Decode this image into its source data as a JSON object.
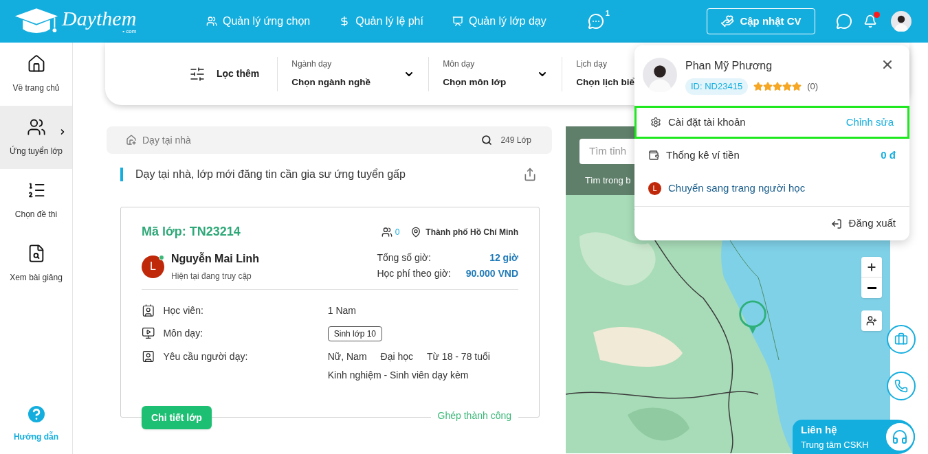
{
  "header": {
    "logo": {
      "name": "Daythem",
      "suffix": "• com"
    },
    "nav": [
      {
        "label": "Quản lý ứng chọn"
      },
      {
        "label": "Quản lý lệ phí"
      },
      {
        "label": "Quản lý lớp dạy"
      }
    ],
    "more_badge": "1",
    "cv_button": "Cập nhật CV",
    "notification_dot": true
  },
  "sidebar": {
    "items": [
      {
        "label": "Về trang chủ",
        "selected": false
      },
      {
        "label": "Ứng tuyển lớp",
        "selected": true
      },
      {
        "label": "Chọn đề thi",
        "selected": false
      },
      {
        "label": "Xem bài giảng",
        "selected": false
      }
    ],
    "help": "Hướng dẫn"
  },
  "filter_bar": {
    "more_filter": "Lọc thêm",
    "filters": [
      {
        "label": "Ngành dạy",
        "value": "Chọn ngành nghề",
        "caret": true
      },
      {
        "label": "Môn dạy",
        "value": "Chọn môn lớp",
        "caret": true
      },
      {
        "label": "Lịch dạy",
        "value": "Chọn lịch biể",
        "caret": false
      }
    ]
  },
  "search_bar": {
    "placeholder": "Dạy tại nhà",
    "count": "249 Lớp"
  },
  "section_title": "Dạy tại nhà, lớp mới đăng tin cần gia sư ứng tuyển gấp",
  "class_card": {
    "code": "Mã lớp: TN23214",
    "applicants": "0",
    "location": "Thành phố Hồ Chí Minh",
    "student": {
      "initial": "L",
      "name": "Nguyễn Mai Linh",
      "online": true,
      "status": "Hiện tại đang truy cập"
    },
    "stats": [
      {
        "label": "Tổng số giờ:",
        "value": "12 giờ"
      },
      {
        "label": "Học phí theo giờ:",
        "value": "90.000 VND"
      }
    ],
    "details": [
      {
        "label": "Học viên:",
        "kind": "text",
        "values": [
          "1 Nam"
        ]
      },
      {
        "label": "Môn dạy:",
        "kind": "tag",
        "values": [
          "Sinh lớp 10"
        ]
      },
      {
        "label": "Yêu cầu người dạy:",
        "kind": "text",
        "values": [
          "Nữ, Nam",
          "Đại học",
          "Từ 18 - 78 tuổi",
          "Kinh nghiệm - Sinh viên dạy kèm"
        ]
      }
    ],
    "button": "Chi tiết lớp",
    "match_status": "Ghép thành công"
  },
  "map": {
    "search_placeholder": "Tìm tỉnh",
    "caption": "Tìm trong b"
  },
  "account_menu": {
    "name": "Phan Mỹ Phương",
    "id": "ID: ND23415",
    "stars": 5,
    "rating_count": "(0)",
    "items": [
      {
        "kind": "setting",
        "label": "Cài đặt tài khoản",
        "action": "Chỉnh sửa",
        "selected": true
      },
      {
        "kind": "wallet",
        "label": "Thống kê ví tiền",
        "action": "0 đ",
        "selected": false
      },
      {
        "kind": "switch",
        "label": "Chuyển sang trang người học",
        "initial": "L",
        "selected": false
      }
    ],
    "logout": "Đăng xuất"
  },
  "contact": {
    "title": "Liên hệ",
    "subtitle": "Trung tâm CSKH"
  }
}
